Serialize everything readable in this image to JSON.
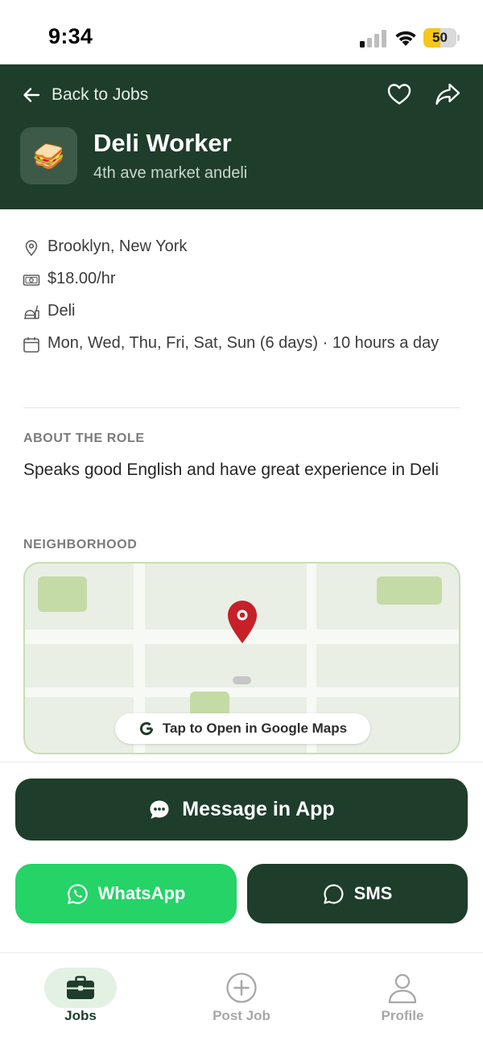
{
  "status_bar": {
    "time": "9:34",
    "battery_level": "50",
    "battery_fraction": 0.5,
    "battery_color": "#f5c61c"
  },
  "header": {
    "back_label": "Back to Jobs",
    "job_icon": "sandwich-icon",
    "job_icon_glyph": "🥪",
    "title": "Deli Worker",
    "subtitle": "4th ave market andeli",
    "favorite_icon": "heart-outline-icon",
    "share_icon": "share-icon",
    "background": "#1e3d2b"
  },
  "details": {
    "location": "Brooklyn, New York",
    "pay": "$18.00/hr",
    "category": "Deli",
    "schedule": "Mon, Wed, Thu, Fri, Sat, Sun (6 days) · 10 hours a day"
  },
  "about": {
    "label": "ABOUT THE ROLE",
    "text": "Speaks good English and have great experience in Deli"
  },
  "neighborhood": {
    "label": "NEIGHBORHOOD",
    "map_button": "Tap to Open in Google Maps",
    "pin_color": "#c62128"
  },
  "actions": {
    "message_label": "Message in App",
    "whatsapp_label": "WhatsApp",
    "sms_label": "SMS",
    "whatsapp_color": "#25d366"
  },
  "tabs": [
    {
      "label": "Jobs",
      "icon": "briefcase-icon",
      "active": true
    },
    {
      "label": "Post Job",
      "icon": "plus-circle-icon",
      "active": false
    },
    {
      "label": "Profile",
      "icon": "person-icon",
      "active": false
    }
  ]
}
